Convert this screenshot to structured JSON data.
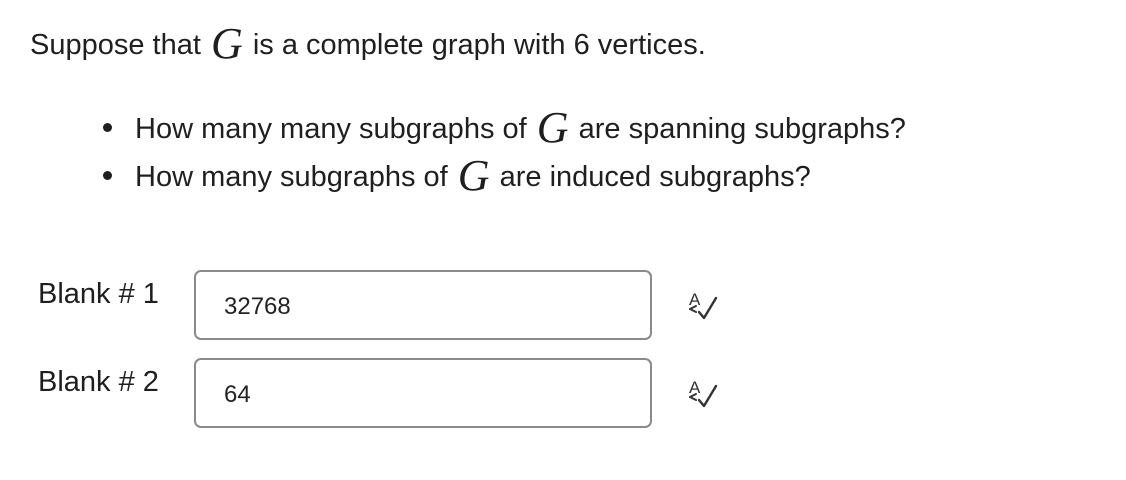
{
  "question": {
    "intro_before": "Suppose that",
    "variable": "G",
    "intro_after": "is a complete graph with 6 vertices.",
    "bullets": [
      {
        "before": "How many many subgraphs of",
        "variable": "G",
        "after": "are spanning subgraphs?"
      },
      {
        "before": "How many subgraphs of",
        "variable": "G",
        "after": "are induced subgraphs?"
      }
    ]
  },
  "blanks": [
    {
      "label": "Blank # 1",
      "value": "32768",
      "icon": "spell-check-icon"
    },
    {
      "label": "Blank # 2",
      "value": "64",
      "icon": "spell-check-icon"
    }
  ]
}
